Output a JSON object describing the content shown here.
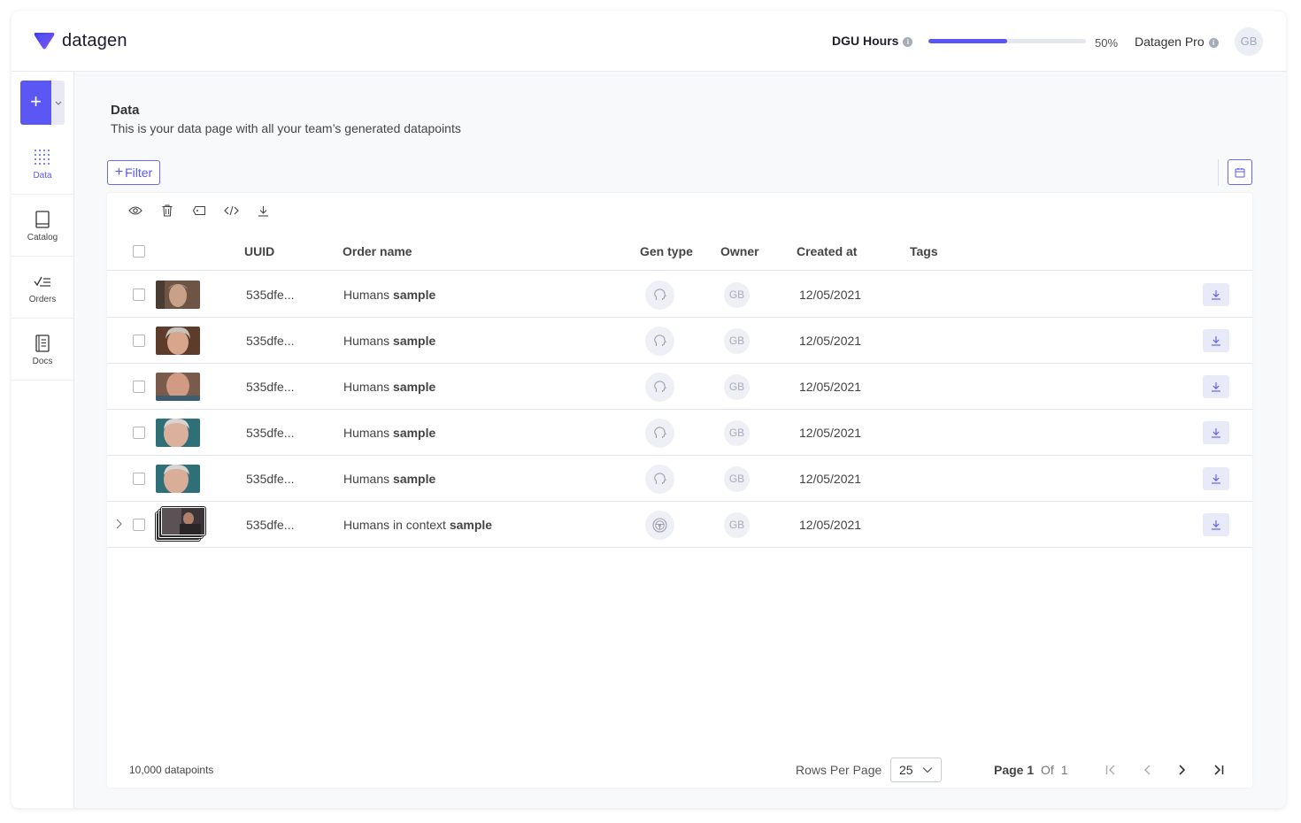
{
  "app": {
    "logo_text": "datagen",
    "brand_color": "#5a57f5"
  },
  "header": {
    "dgu_label": "DGU Hours",
    "dgu_progress": 0.5,
    "dgu_percent_text": "50%",
    "plan_label": "Datagen Pro",
    "avatar_initials": "GB"
  },
  "sidebar": {
    "create_icon": "plus-icon",
    "items": [
      {
        "label": "Data",
        "icon": "grid-dots-icon",
        "active": true
      },
      {
        "label": "Catalog",
        "icon": "book-icon",
        "active": false
      },
      {
        "label": "Orders",
        "icon": "checklist-icon",
        "active": false
      },
      {
        "label": "Docs",
        "icon": "document-icon",
        "active": false
      }
    ]
  },
  "page": {
    "title": "Data",
    "subtitle": "This is your data page with all your team’s generated datapoints",
    "filter_label": "Filter"
  },
  "toolbar": {
    "icons": [
      "eye-icon",
      "trash-icon",
      "tag-icon",
      "code-icon",
      "download-icon"
    ]
  },
  "table": {
    "columns": {
      "uuid": "UUID",
      "order_name": "Order name",
      "gen_type": "Gen type",
      "owner": "Owner",
      "created_at": "Created at",
      "tags": "Tags"
    },
    "rows": [
      {
        "uuid": "535dfe...",
        "name_prefix": "Humans ",
        "name_bold": "sample",
        "gen_type_icon": "head-profile-icon",
        "owner": "GB",
        "created_at": "12/05/2021",
        "expandable": false
      },
      {
        "uuid": "535dfe...",
        "name_prefix": "Humans ",
        "name_bold": "sample",
        "gen_type_icon": "head-profile-icon",
        "owner": "GB",
        "created_at": "12/05/2021",
        "expandable": false
      },
      {
        "uuid": "535dfe...",
        "name_prefix": "Humans ",
        "name_bold": "sample",
        "gen_type_icon": "head-profile-icon",
        "owner": "GB",
        "created_at": "12/05/2021",
        "expandable": false
      },
      {
        "uuid": "535dfe...",
        "name_prefix": "Humans ",
        "name_bold": "sample",
        "gen_type_icon": "head-profile-icon",
        "owner": "GB",
        "created_at": "12/05/2021",
        "expandable": false
      },
      {
        "uuid": "535dfe...",
        "name_prefix": "Humans ",
        "name_bold": "sample",
        "gen_type_icon": "head-profile-icon",
        "owner": "GB",
        "created_at": "12/05/2021",
        "expandable": false
      },
      {
        "uuid": "535dfe...",
        "name_prefix": "Humans in context ",
        "name_bold": "sample",
        "gen_type_icon": "steering-wheel-icon",
        "owner": "GB",
        "created_at": "12/05/2021",
        "expandable": true
      }
    ]
  },
  "footer": {
    "count": "10,000 datapoints",
    "rows_per_page_label": "Rows Per Page",
    "rows_per_page_value": "25",
    "page_label": "Page",
    "page_current": "1",
    "of_label": "Of",
    "page_total": "1"
  }
}
